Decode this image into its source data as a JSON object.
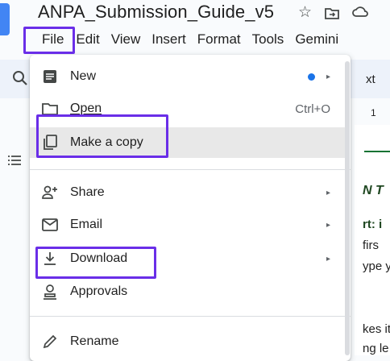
{
  "app": {
    "doc_title": "ANPA_Submission_Guide_v5",
    "title_icons": {
      "star": "star-icon",
      "move": "move-to-folder-icon",
      "cloud": "cloud-status-icon"
    },
    "accent": "#1a73e8",
    "annotation_color": "#6a2ee8"
  },
  "menubar": {
    "items": [
      "File",
      "Edit",
      "View",
      "Insert",
      "Format",
      "Tools",
      "Gemini"
    ]
  },
  "toolbar": {
    "search_icon": "search-icon",
    "partial_text": "xt"
  },
  "ruler": {
    "partial_number": "1"
  },
  "document": {
    "lines": [
      "N T",
      "rt: i",
      "firs",
      "ype y",
      "kes it",
      "ng le"
    ]
  },
  "file_menu": {
    "items": [
      {
        "label": "New",
        "icon": "document-icon",
        "has_submenu": true,
        "badge": "blue-dot"
      },
      {
        "label": "Open",
        "icon": "folder-icon",
        "shortcut": "Ctrl+O"
      },
      {
        "label": "Make a copy",
        "icon": "copy-icon",
        "highlighted": true
      },
      {
        "label": "Share",
        "icon": "share-person-icon",
        "has_submenu": true
      },
      {
        "label": "Email",
        "icon": "email-icon",
        "has_submenu": true
      },
      {
        "label": "Download",
        "icon": "download-icon",
        "has_submenu": true
      },
      {
        "label": "Approvals",
        "icon": "approvals-icon"
      },
      {
        "label": "Rename",
        "icon": "pencil-icon"
      }
    ],
    "submenu_arrow": "▸"
  }
}
